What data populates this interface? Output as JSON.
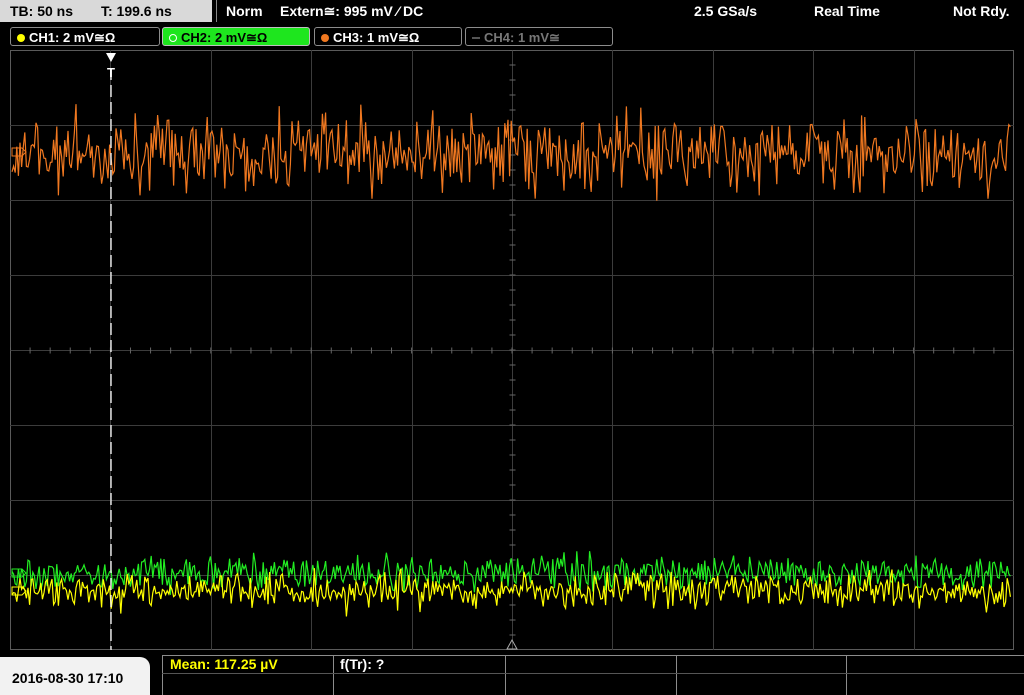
{
  "topbar": {
    "timebase": "TB: 50 ns",
    "trigger_time": "T: 199.6 ns",
    "mode": "Norm",
    "trigger_source": "Extern≅: 995 mV ⁄ DC",
    "sample_rate": "2.5 GSa/s",
    "acq_mode": "Real Time",
    "status": "Not Rdy."
  },
  "channels": [
    {
      "label": "CH1: 2 mV≅Ω",
      "color": "#ffff00",
      "active": true
    },
    {
      "label": "CH2: 2 mV≅Ω",
      "color": "#22ee22",
      "active": true,
      "selected": true
    },
    {
      "label": "CH3: 1 mV≅Ω",
      "color": "#f07820",
      "active": true
    },
    {
      "label": "CH4: 1 mV≅",
      "color": "#777777",
      "active": false
    }
  ],
  "markers": {
    "trigger_position": "T"
  },
  "bottom": {
    "datetime": "2016-08-30 17:10",
    "measurement_mean": "Mean: 117.25 µV",
    "measurement_ftr": "f(Tr): ?"
  },
  "colors": {
    "grid": "#3c3c3c",
    "ch1": "#ffff00",
    "ch2": "#22ee22",
    "ch3": "#f07820"
  }
}
